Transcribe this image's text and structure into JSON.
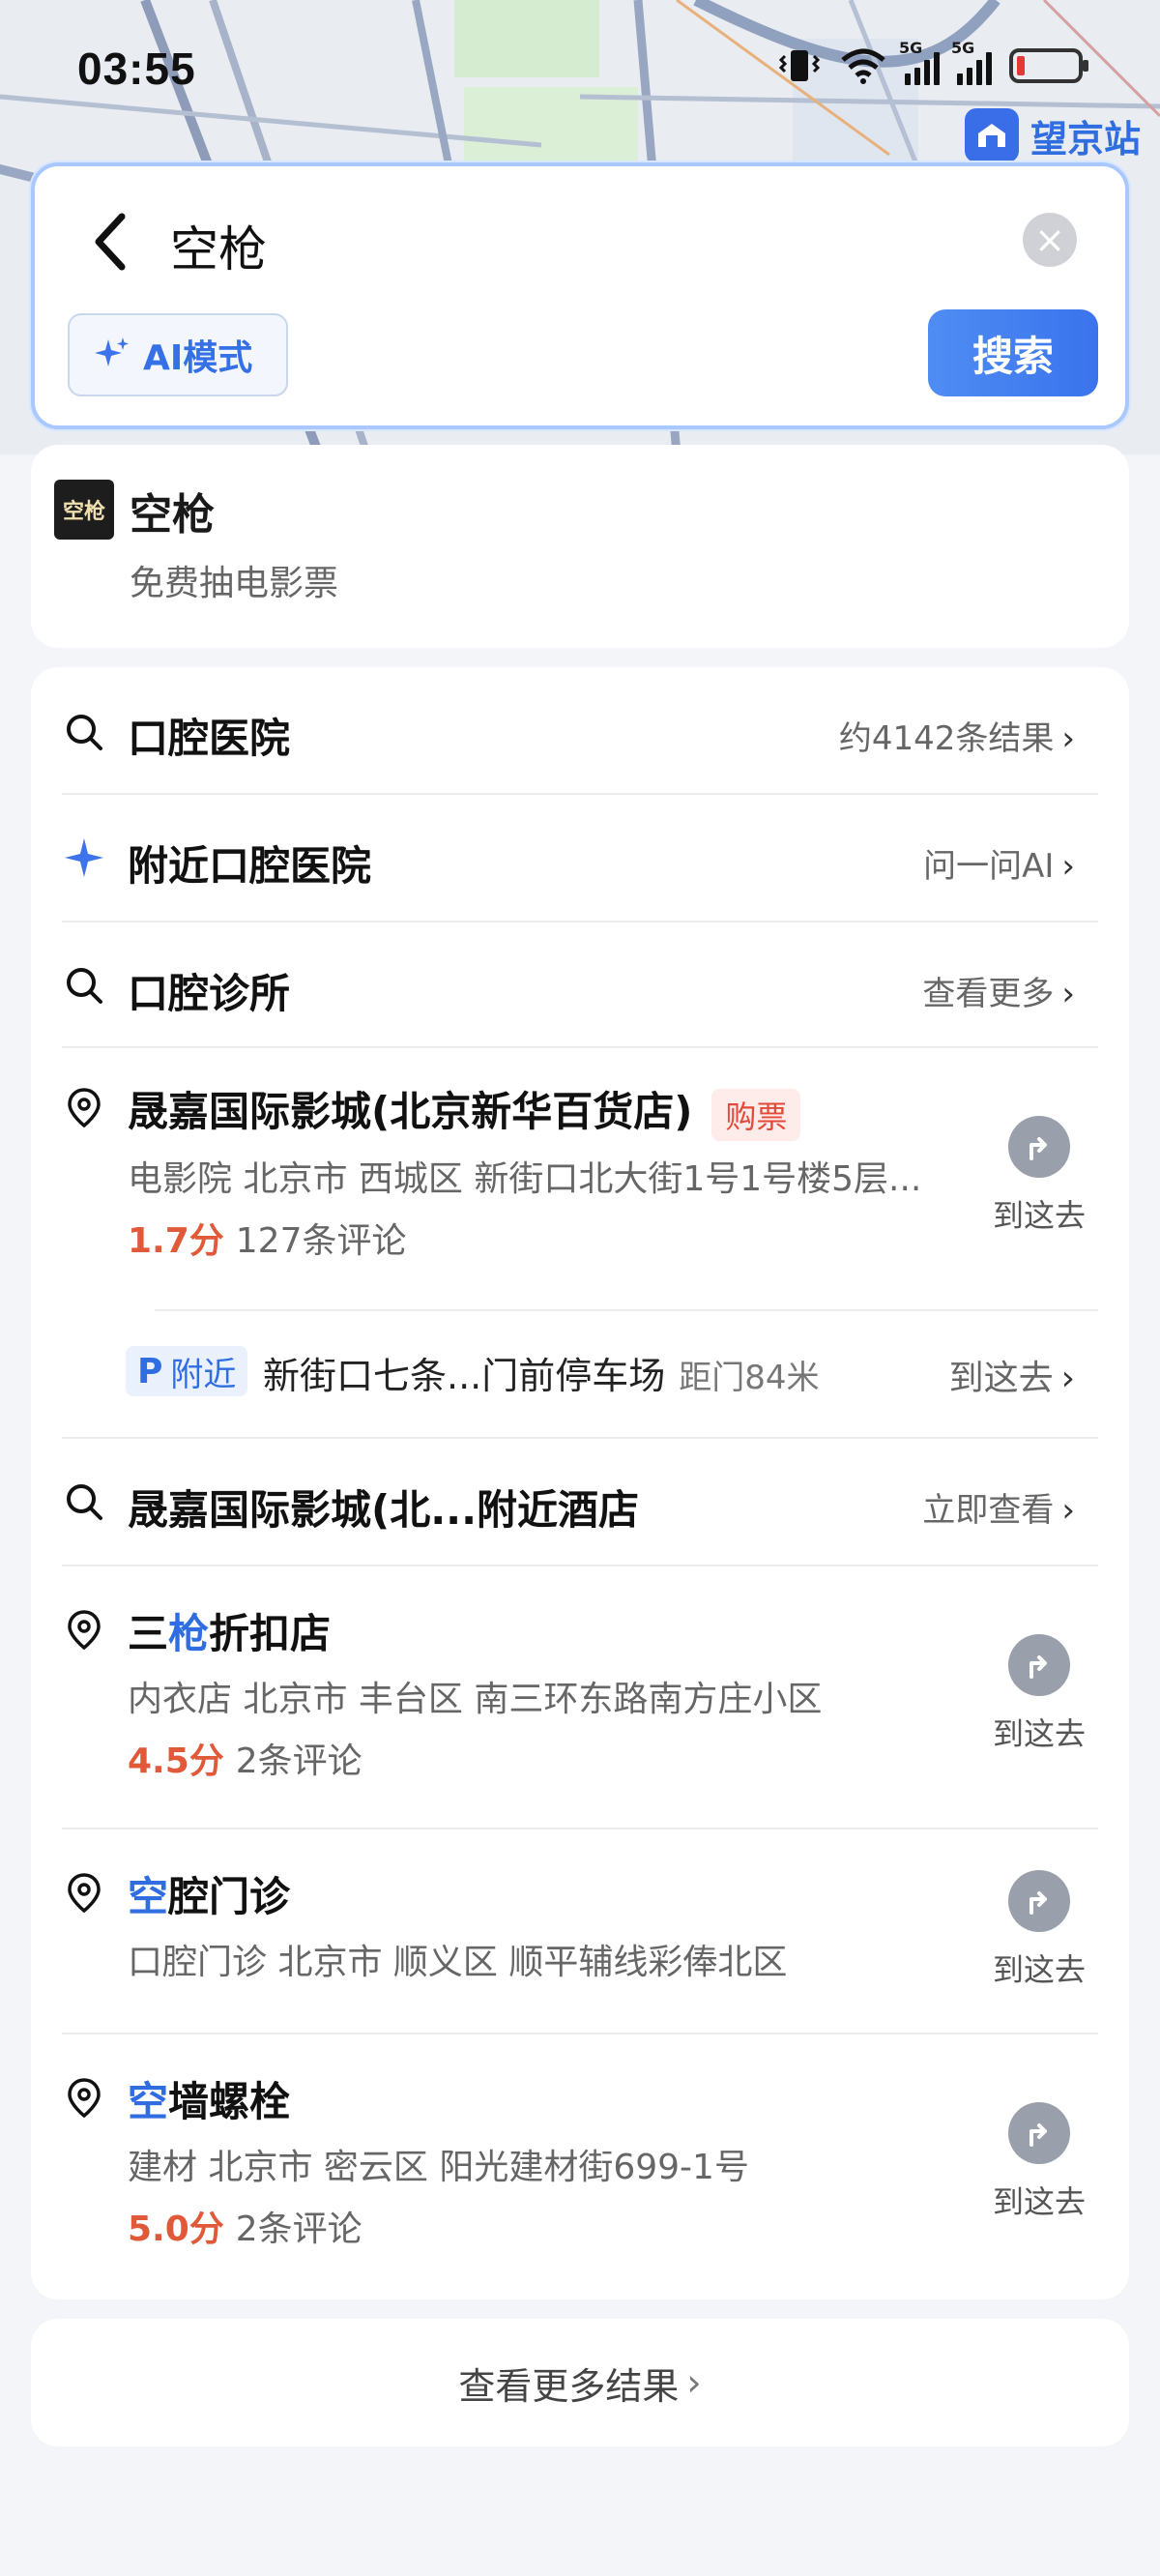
{
  "status_bar": {
    "time": "03:55",
    "network_1": "5G",
    "network_2": "5G",
    "battery_color": "#e53935"
  },
  "map": {
    "station_icon": "metro-station-icon",
    "station_label": "望京站"
  },
  "search": {
    "query": "空枪",
    "ai_mode_label": "AI模式",
    "search_button": "搜索"
  },
  "top_suggestion": {
    "title": "空枪",
    "subtitle": "免费抽电影票",
    "thumb_text": "空枪"
  },
  "results": {
    "r1": {
      "title": "口腔医院",
      "right": "约4142条结果"
    },
    "r2": {
      "title": "附近口腔医院",
      "right": "问一问AI"
    },
    "r3": {
      "title": "口腔诊所",
      "right": "查看更多"
    },
    "poi1": {
      "title": "晟嘉国际影城(北京新华百货店)",
      "tag": "购票",
      "meta": "电影院  北京市 西城区 新街口北大街1号1号楼5层...",
      "score": "1.7分",
      "reviews": "127条评论",
      "goto": "到这去"
    },
    "parking": {
      "badge_p": "P",
      "badge_text": "附近",
      "name": "新街口七条...门前停车场",
      "distance": "距门84米",
      "right": "到这去"
    },
    "r4": {
      "title": "晟嘉国际影城(北...附近酒店",
      "right": "立即查看"
    },
    "poi2": {
      "title_pre": "三",
      "title_hl": "枪",
      "title_post": "折扣店",
      "meta": "内衣店  北京市 丰台区 南三环东路南方庄小区",
      "score": "4.5分",
      "reviews": "2条评论",
      "goto": "到这去"
    },
    "poi3": {
      "title_hl": "空",
      "title_post": "腔门诊",
      "meta": "口腔门诊  北京市 顺义区 顺平辅线彩俸北区",
      "goto": "到这去"
    },
    "poi4": {
      "title_hl": "空",
      "title_post": "墙螺栓",
      "meta": "建材  北京市 密云区 阳光建材街699-1号",
      "score": "5.0分",
      "reviews": "2条评论",
      "goto": "到这去"
    }
  },
  "more_results": "查看更多结果"
}
